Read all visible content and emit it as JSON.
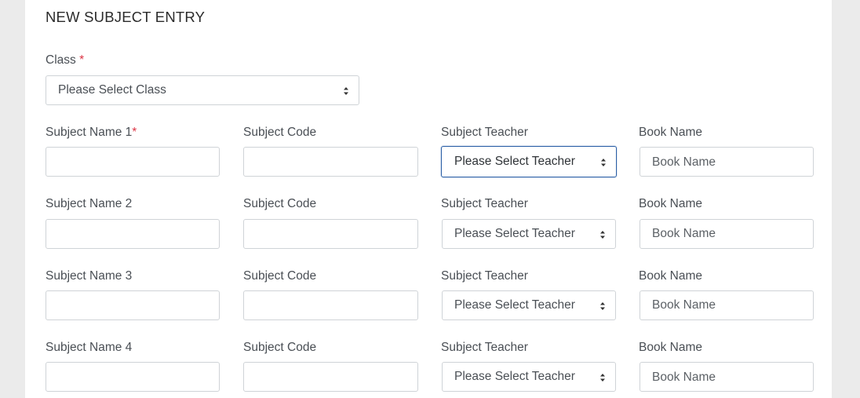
{
  "page": {
    "title": "NEW SUBJECT ENTRY"
  },
  "class_field": {
    "label": "Class",
    "required_mark": "*",
    "selected": "Please Select Class"
  },
  "rows": [
    {
      "subject_label": "Subject Name 1",
      "subject_required_mark": "*",
      "subject_value": "",
      "code_label": "Subject Code",
      "code_value": "",
      "teacher_label": "Subject Teacher",
      "teacher_selected": "Please Select Teacher",
      "book_label": "Book Name",
      "book_placeholder": "Book Name"
    },
    {
      "subject_label": "Subject Name 2",
      "subject_value": "",
      "code_label": "Subject Code",
      "code_value": "",
      "teacher_label": "Subject Teacher",
      "teacher_selected": "Please Select Teacher",
      "book_label": "Book Name",
      "book_placeholder": "Book Name"
    },
    {
      "subject_label": "Subject Name 3",
      "subject_value": "",
      "code_label": "Subject Code",
      "code_value": "",
      "teacher_label": "Subject Teacher",
      "teacher_selected": "Please Select Teacher",
      "book_label": "Book Name",
      "book_placeholder": "Book Name"
    },
    {
      "subject_label": "Subject Name 4",
      "subject_value": "",
      "code_label": "Subject Code",
      "code_value": "",
      "teacher_label": "Subject Teacher",
      "teacher_selected": "Please Select Teacher",
      "book_label": "Book Name",
      "book_placeholder": "Book Name"
    }
  ],
  "colors": {
    "required": "#dc3545",
    "focus_border": "#2b5fa6"
  },
  "icons": {
    "select_caret": "sort-caret-icon"
  }
}
